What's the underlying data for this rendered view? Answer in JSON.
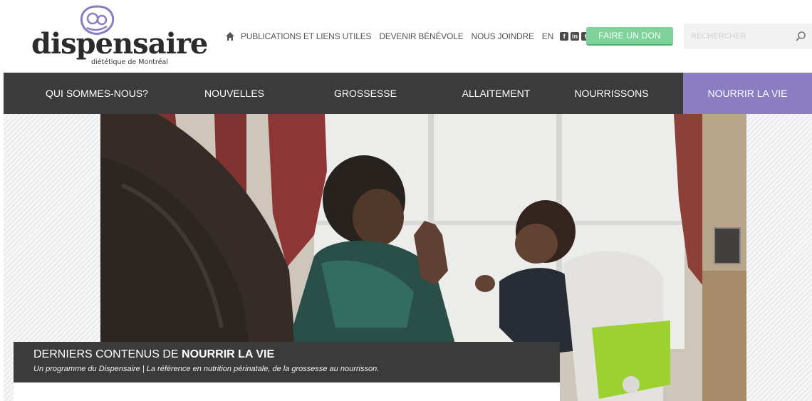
{
  "brand": {
    "name": "dispensaire",
    "tagline": "diététique de Montréal",
    "accent": "#8b7dc2",
    "donate_color": "#7ed39a",
    "nav_bg": "#3b3b3b"
  },
  "topnav": {
    "home_icon": "home-icon",
    "links": [
      "PUBLICATIONS ET LIENS UTILES",
      "DEVENIR BÉNÉVOLE",
      "NOUS JOINDRE",
      "EN"
    ],
    "social_icons": [
      "facebook-icon",
      "linkedin-icon",
      "twitter-icon"
    ],
    "donate_label": "FAIRE UN DON"
  },
  "search": {
    "placeholder": "RECHERCHER",
    "icon": "search-icon"
  },
  "mainnav": {
    "items": [
      "QUI SOMMES-NOUS?",
      "NOUVELLES",
      "GROSSESSE",
      "ALLAITEMENT",
      "NOURRISSONS",
      "NOURRIR LA VIE"
    ],
    "active_index": 5
  },
  "hero": {
    "caption_prefix": "DERNIERS CONTENUS DE ",
    "caption_bold": "NOURRIR LA VIE",
    "subtitle": "Un programme du Dispensaire | La référence en nutrition périnatale, de la grossesse au nourrisson."
  }
}
